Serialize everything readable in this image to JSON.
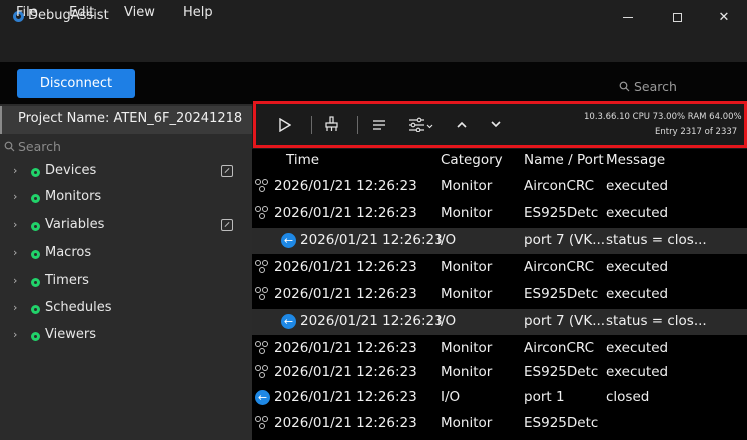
{
  "window": {
    "title": "DebugAssist"
  },
  "menu": [
    "File",
    "Edit",
    "View",
    "Help"
  ],
  "actions": {
    "disconnect_label": "Disconnect",
    "search_placeholder": "Search"
  },
  "sidebar": {
    "project_name": "Project Name: ATEN_6F_20241218",
    "search_placeholder": "Search",
    "items": [
      {
        "label": "Devices",
        "has_external": true
      },
      {
        "label": "Monitors",
        "has_external": false
      },
      {
        "label": "Variables",
        "has_external": true
      },
      {
        "label": "Macros",
        "has_external": false
      },
      {
        "label": "Timers",
        "has_external": false
      },
      {
        "label": "Schedules",
        "has_external": false
      },
      {
        "label": "Viewers",
        "has_external": false
      }
    ]
  },
  "toolbar": {
    "icons": [
      "play-icon",
      "broom-icon",
      "wrap-lines-icon",
      "filter-icon",
      "chevron-up-icon",
      "chevron-down-icon"
    ],
    "status_line": "10.3.66.10  CPU 73.00%  RAM 64.00%",
    "entry_line": "Entry 2317 of 2337",
    "accent_color": "#e4161c"
  },
  "log": {
    "columns": {
      "time": "Time",
      "category": "Category",
      "name": "Name / Port",
      "message": "Message"
    },
    "rows": [
      {
        "icon": "network-icon",
        "time": "2026/01/21 12:26:23",
        "category": "Monitor",
        "name": "AirconCRC",
        "message": "executed",
        "child": false
      },
      {
        "icon": "network-icon",
        "time": "2026/01/21 12:26:23",
        "category": "Monitor",
        "name": "ES925Detc",
        "message": "executed",
        "child": false
      },
      {
        "icon": "arrow-left-icon",
        "time": "2026/01/21 12:26:23",
        "category": "I/O",
        "name": "port 7 (VK...",
        "message": "status = clos...",
        "child": true
      },
      {
        "icon": "network-icon",
        "time": "2026/01/21 12:26:23",
        "category": "Monitor",
        "name": "AirconCRC",
        "message": "executed",
        "child": false
      },
      {
        "icon": "network-icon",
        "time": "2026/01/21 12:26:23",
        "category": "Monitor",
        "name": "ES925Detc",
        "message": "executed",
        "child": false
      },
      {
        "icon": "arrow-left-icon",
        "time": "2026/01/21 12:26:23",
        "category": "I/O",
        "name": "port 7 (VK...",
        "message": "status = clos...",
        "child": true
      },
      {
        "icon": "network-icon",
        "time": "2026/01/21 12:26:23",
        "category": "Monitor",
        "name": "AirconCRC",
        "message": "executed",
        "child": false
      },
      {
        "icon": "network-icon",
        "time": "2026/01/21 12:26:23",
        "category": "Monitor",
        "name": "ES925Detc",
        "message": "executed",
        "child": false
      },
      {
        "icon": "arrow-left-icon",
        "time": "2026/01/21 12:26:23",
        "category": "I/O",
        "name": "port 1",
        "message": "closed",
        "child": false
      },
      {
        "icon": "network-icon",
        "time": "2026/01/21 12:26:23",
        "category": "Monitor",
        "name": "ES925Detc",
        "message": "",
        "child": false
      }
    ]
  }
}
